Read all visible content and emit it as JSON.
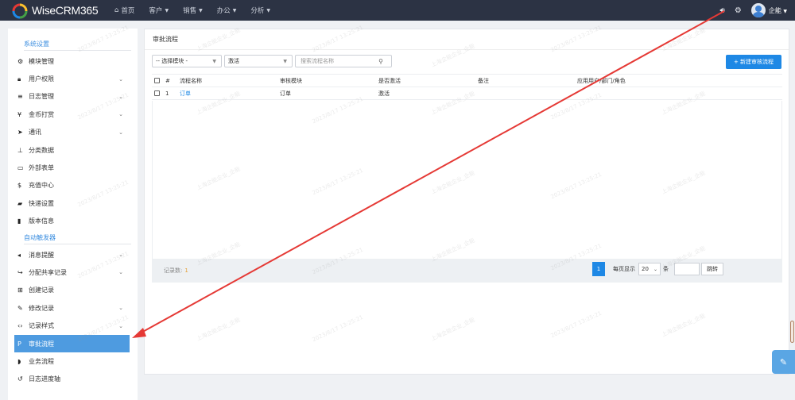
{
  "app": {
    "name": "WiseCRM365"
  },
  "nav": {
    "home": "首页",
    "items": [
      "客户",
      "销售",
      "办公",
      "分析"
    ]
  },
  "user": {
    "name": "企能"
  },
  "sidebar": {
    "section1": "系统设置",
    "items1": [
      {
        "label": "模块管理",
        "icon": "gear-icon",
        "chevron": false
      },
      {
        "label": "用户权限",
        "icon": "lock-icon",
        "chevron": true
      },
      {
        "label": "日志管理",
        "icon": "list-icon",
        "chevron": true
      },
      {
        "label": "金币打赏",
        "icon": "yen-icon",
        "chevron": true
      },
      {
        "label": "通讯",
        "icon": "send-icon",
        "chevron": true
      },
      {
        "label": "分类数据",
        "icon": "sitemap-icon",
        "chevron": false
      },
      {
        "label": "外部表单",
        "icon": "form-icon",
        "chevron": false
      },
      {
        "label": "充值中心",
        "icon": "dollar-icon",
        "chevron": false
      },
      {
        "label": "快递设置",
        "icon": "truck-icon",
        "chevron": false
      },
      {
        "label": "版本信息",
        "icon": "book-icon",
        "chevron": false
      }
    ],
    "section2": "自动触发器",
    "items2": [
      {
        "label": "消息提醒",
        "icon": "volume-icon",
        "chevron": true
      },
      {
        "label": "分配共享记录",
        "icon": "share-icon",
        "chevron": true
      },
      {
        "label": "创建记录",
        "icon": "plus-square-icon",
        "chevron": false
      },
      {
        "label": "修改记录",
        "icon": "pencil-icon",
        "chevron": true
      },
      {
        "label": "记录样式",
        "icon": "code-icon",
        "chevron": true
      },
      {
        "label": "审批流程",
        "icon": "paragraph-icon",
        "chevron": false,
        "active": true
      },
      {
        "label": "业务流程",
        "icon": "shield-icon",
        "chevron": false
      },
      {
        "label": "日志进度轴",
        "icon": "history-icon",
        "chevron": false
      }
    ]
  },
  "main": {
    "title": "审批流程",
    "filter_module": "-- 选择模块 -",
    "filter_status": "激活",
    "search_placeholder": "搜索流程名称",
    "new_button": "+ 新建审核流程",
    "columns": [
      "#",
      "流程名称",
      "审核模块",
      "是否激活",
      "备注",
      "应用用户/部门/角色"
    ],
    "rows": [
      {
        "index": "1",
        "name": "订单",
        "module": "订单",
        "active": "激活",
        "remark": "",
        "apply": ""
      }
    ],
    "record_label": "记录数:",
    "record_count": "1",
    "page": "1",
    "per_page_label": "每页显示",
    "per_page": "20",
    "per_page_unit": "条",
    "jump": "跳转"
  },
  "watermark": {
    "text1": "2023/8/17 13:25:21",
    "text2": "上海企能企业_企能"
  },
  "colors": {
    "accent": "#1e88e5",
    "active_menu": "#4e9be0",
    "topbar": "#2c3344",
    "annotation": "#e53935"
  }
}
